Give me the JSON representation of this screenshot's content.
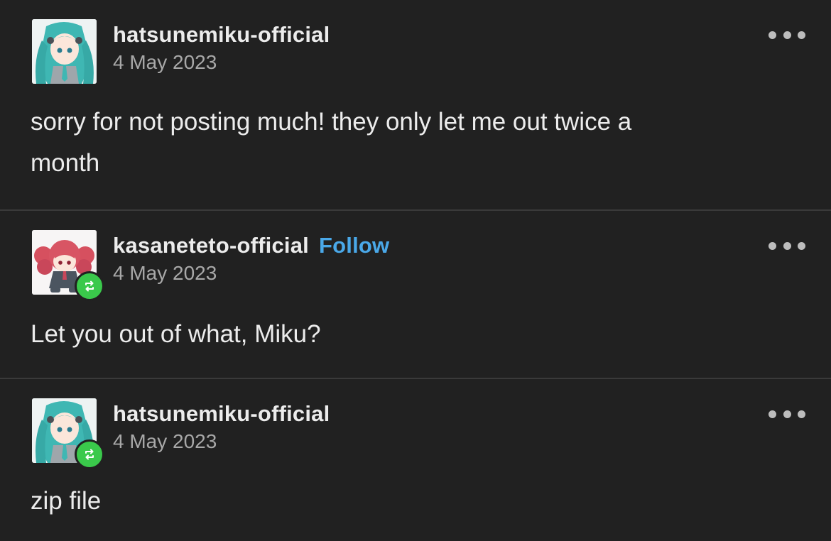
{
  "posts": [
    {
      "username": "hatsunemiku-official",
      "date": "4 May 2023",
      "body_line1": "sorry for not posting much! they only let me out twice a",
      "body_line2": "month",
      "follow": "",
      "reblogged": false
    },
    {
      "username": "kasaneteto-official",
      "date": "4 May 2023",
      "body_line1": "Let you out of what, Miku?",
      "body_line2": "",
      "follow": "Follow",
      "reblogged": true
    },
    {
      "username": "hatsunemiku-official",
      "date": "4 May 2023",
      "body_line1": "zip file",
      "body_line2": "",
      "follow": "",
      "reblogged": true
    }
  ],
  "colors": {
    "background": "#212121",
    "divider": "#3a3a3a",
    "text": "#ececec",
    "muted": "#a8a8a8",
    "follow": "#4aa8e8",
    "reblog_badge": "#3ac94b"
  },
  "icons": {
    "more": "more-options-icon",
    "reblog": "reblog-icon"
  }
}
